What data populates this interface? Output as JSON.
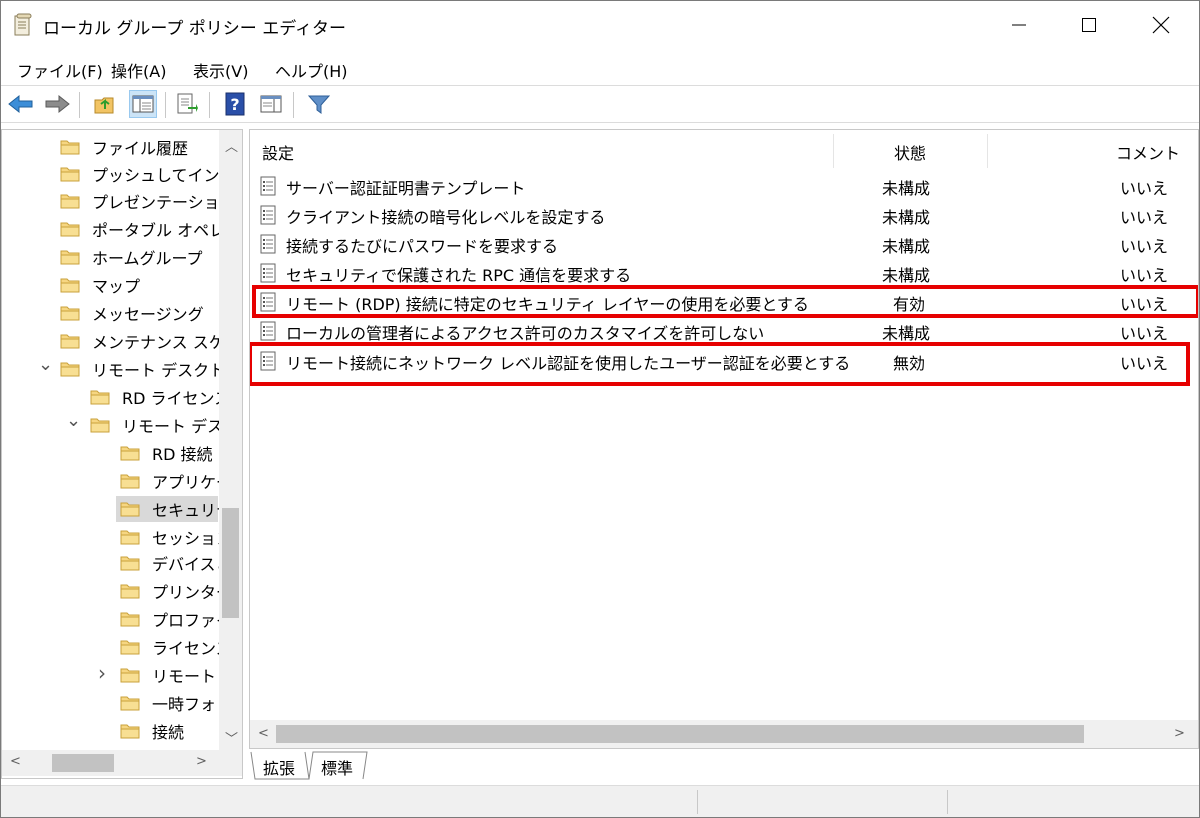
{
  "window": {
    "title": "ローカル グループ ポリシー エディター"
  },
  "menu": [
    {
      "label": "ファイル(F)"
    },
    {
      "label": "操作(A)"
    },
    {
      "label": "表示(V)"
    },
    {
      "label": "ヘルプ(H)"
    }
  ],
  "toolbar": {
    "buttons": [
      "back-arrow-icon",
      "forward-arrow-icon",
      "up-folder-icon",
      "show-hide-tree-icon",
      "export-list-icon",
      "help-icon",
      "extended-view-icon",
      "filter-icon"
    ]
  },
  "tree": {
    "items": [
      {
        "label": "ファイル履歴"
      },
      {
        "label": "プッシュしてインス"
      },
      {
        "label": "プレゼンテーション"
      },
      {
        "label": "ポータブル オペレ"
      },
      {
        "label": "ホームグループ"
      },
      {
        "label": "マップ"
      },
      {
        "label": "メッセージング"
      },
      {
        "label": "メンテナンス スケジ"
      },
      {
        "label": "リモート デスクトッ"
      },
      {
        "label": "RD ライセンス"
      },
      {
        "label": "リモート デスク"
      },
      {
        "label": "RD 接続"
      },
      {
        "label": "アプリケー"
      },
      {
        "label": "セキュリテ"
      },
      {
        "label": "セッション"
      },
      {
        "label": "デバイスと"
      },
      {
        "label": "プリンター"
      },
      {
        "label": "プロファイ"
      },
      {
        "label": "ライセンス"
      },
      {
        "label": "リモート セ"
      },
      {
        "label": "一時フォ"
      },
      {
        "label": "接続"
      }
    ]
  },
  "list": {
    "columns": {
      "setting": "設定",
      "state": "状態",
      "comment": "コメント"
    },
    "rows": [
      {
        "name": "サーバー認証証明書テンプレート",
        "state": "未構成",
        "comment": "いいえ",
        "highlighted": false
      },
      {
        "name": "クライアント接続の暗号化レベルを設定する",
        "state": "未構成",
        "comment": "いいえ",
        "highlighted": false
      },
      {
        "name": "接続するたびにパスワードを要求する",
        "state": "未構成",
        "comment": "いいえ",
        "highlighted": false
      },
      {
        "name": "セキュリティで保護された RPC 通信を要求する",
        "state": "未構成",
        "comment": "いいえ",
        "highlighted": false
      },
      {
        "name": "リモート (RDP) 接続に特定のセキュリティ レイヤーの使用を必要とする",
        "state": "有効",
        "comment": "いいえ",
        "highlighted": true
      },
      {
        "name": "ローカルの管理者によるアクセス許可のカスタマイズを許可しない",
        "state": "未構成",
        "comment": "いいえ",
        "highlighted": false
      },
      {
        "name": "リモート接続にネットワーク レベル認証を使用したユーザー認証を必要とする",
        "state": "無効",
        "comment": "いいえ",
        "highlighted": true
      }
    ]
  },
  "tabs": [
    {
      "label": "拡張"
    },
    {
      "label": "標準"
    }
  ],
  "colors": {
    "highlight_box": "#e60000",
    "selected_tree": "#d9d9d9"
  }
}
